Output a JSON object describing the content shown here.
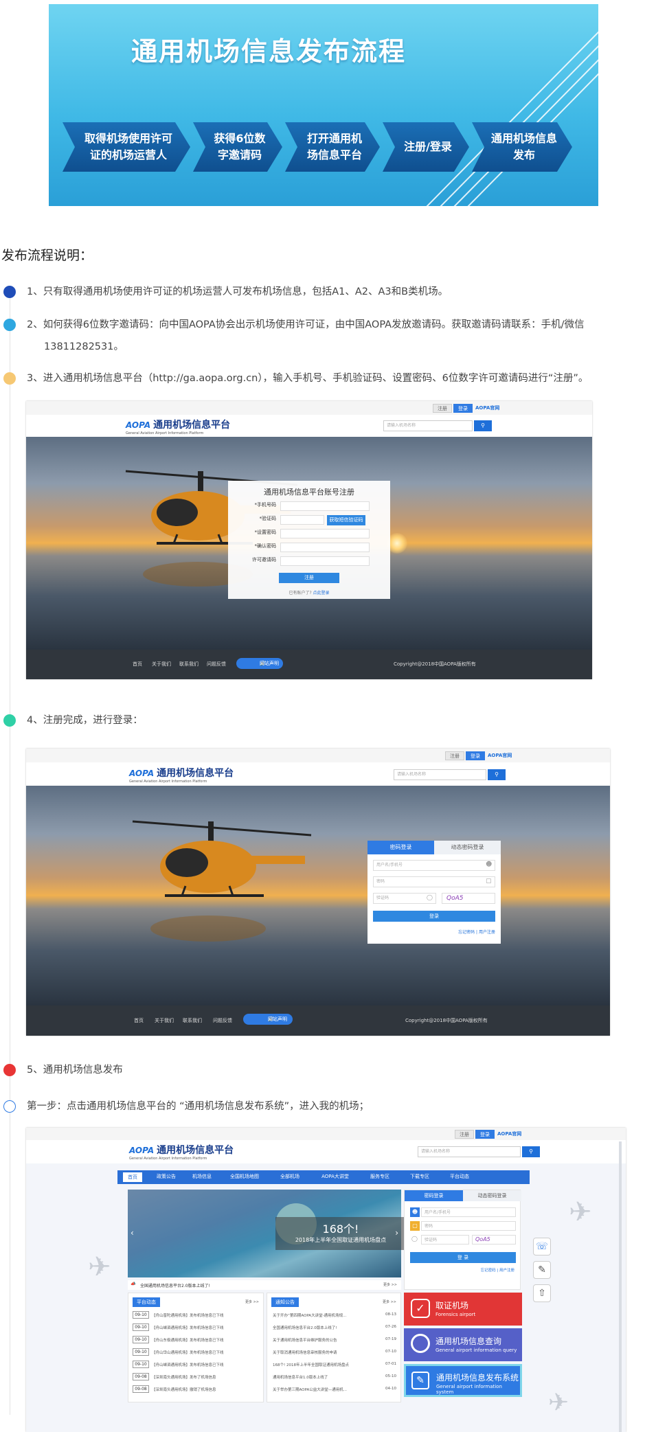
{
  "banner": {
    "title": "通用机场信息发布流程",
    "steps": [
      "取得机场使用许可证的机场运营人",
      "获得6位数字邀请码",
      "打开通用机场信息平台",
      "注册/登录",
      "通用机场信息发布"
    ]
  },
  "heading": "发布流程说明：",
  "paragraphs": {
    "p1": "1、只有取得通用机场使用许可证的机场运营人可发布机场信息，包括A1、A2、A3和B类机场。",
    "p2a": "2、如何获得6位数字邀请码：向中国AOPA协会出示机场使用许可证，由中国AOPA发放邀请码。获取邀请码请联系：手机/微信",
    "p2b": "13811282531。",
    "p3": "3、进入通用机场信息平台（http://ga.aopa.org.cn），输入手机号、手机验证码、设置密码、6位数字许可邀请码进行“注册”。",
    "p4": "4、注册完成，进行登录：",
    "p5": "5、通用机场信息发布",
    "p6": "第一步：点击通用机场信息平台的 “通用机场信息发布系统”，进入我的机场；"
  },
  "colors": {
    "dot1": "#1f4db8",
    "dot2": "#2ea7e0",
    "dot3": "#f6c873",
    "dot4": "#2fd0a6",
    "dot5": "#e83535",
    "dot6": "#ffffff"
  },
  "platform": {
    "logo_mark": "AOPA",
    "logo_name": "通用机场信息平台",
    "logo_sub": "General Aviation Airport Information Platform",
    "top_register": "注册",
    "top_login": "登录",
    "top_site": "AOPA官网",
    "search_placeholder": "请输入机场名称",
    "search_icon": "search-icon",
    "footer_links": [
      "首页",
      "关于我们",
      "联系我们",
      "问题反馈"
    ],
    "footer_notice": "网站声明",
    "copyright": "Copyright@2018中国AOPA版权所有"
  },
  "register_form": {
    "title": "通用机场信息平台账号注册",
    "labels": [
      "*手机号码",
      "*验证码",
      "*设置密码",
      "*确认密码",
      "许可邀请码"
    ],
    "get_code": "获取短信验证码",
    "submit": "注册",
    "have_account": "已有账户了?",
    "login_link": "点此登录"
  },
  "login_form": {
    "tab_password": "密码登录",
    "tab_sms": "动态密码登录",
    "ph_user": "用户名/手机号",
    "ph_password": "密码",
    "ph_captcha": "验证码",
    "captcha_text": "QoA5",
    "submit": "登录",
    "forgot": "忘记密码",
    "register": "用户注册"
  },
  "portal": {
    "nav": [
      "首页",
      "政策公告",
      "机场信息",
      "全国机场地图",
      "全部机场",
      "AOPA大讲堂",
      "服务专区",
      "下载专区",
      "平台动态"
    ],
    "slide_big": "168个!",
    "slide_caption": "2018年上半年全国取证通用机场盘点",
    "marquee": "全国通用机场信息平台2.0版本上线了!",
    "more": "更多 >>",
    "platform_news_title": "平台动态",
    "notices_title": "通知公告",
    "news": [
      {
        "date": "09-10",
        "text": "【舟山普陀通用机场】发布机场信息已下线"
      },
      {
        "date": "09-10",
        "text": "【舟山嵊泗通用机场】发布机场信息已下线"
      },
      {
        "date": "09-10",
        "text": "【舟山东极通用机场】发布机场信息已下线"
      },
      {
        "date": "09-10",
        "text": "【舟山岱山通用机场】发布机场信息已下线"
      },
      {
        "date": "09-10",
        "text": "【舟山嵊泗通用机场】发布机场信息已下线"
      },
      {
        "date": "09-08",
        "text": "【深圳南头通用机场】发布了机场信息"
      },
      {
        "date": "09-08",
        "text": "【深圳南头通用机场】撤销了机场信息"
      }
    ],
    "notices": [
      {
        "text": "关于开办“第四期AOPA大讲堂-通用机场规...",
        "date": "08-13"
      },
      {
        "text": "全国通用机场信息平台2.0版本上线了!",
        "date": "07-26"
      },
      {
        "text": "关于通用机场信息平台维护服务的公告",
        "date": "07-19"
      },
      {
        "text": "关于取消通用机场信息审核服务的申请",
        "date": "07-10"
      },
      {
        "text": "168个! 2018年上半年全国取证通用机场盘点",
        "date": "07-01"
      },
      {
        "text": "通用机场信息平台1.0版本上线了",
        "date": "05-10"
      },
      {
        "text": "关于举办第三期AOPA公益大讲堂—通用机...",
        "date": "04-10"
      }
    ],
    "tiles": [
      {
        "t1": "取证机场",
        "t2": "Forensics airport"
      },
      {
        "t1": "通用机场信息查询",
        "t2": "General airport information query"
      },
      {
        "t1": "通用机场信息发布系统",
        "t2": "General airport information system"
      }
    ],
    "login_submit": "登 录"
  }
}
